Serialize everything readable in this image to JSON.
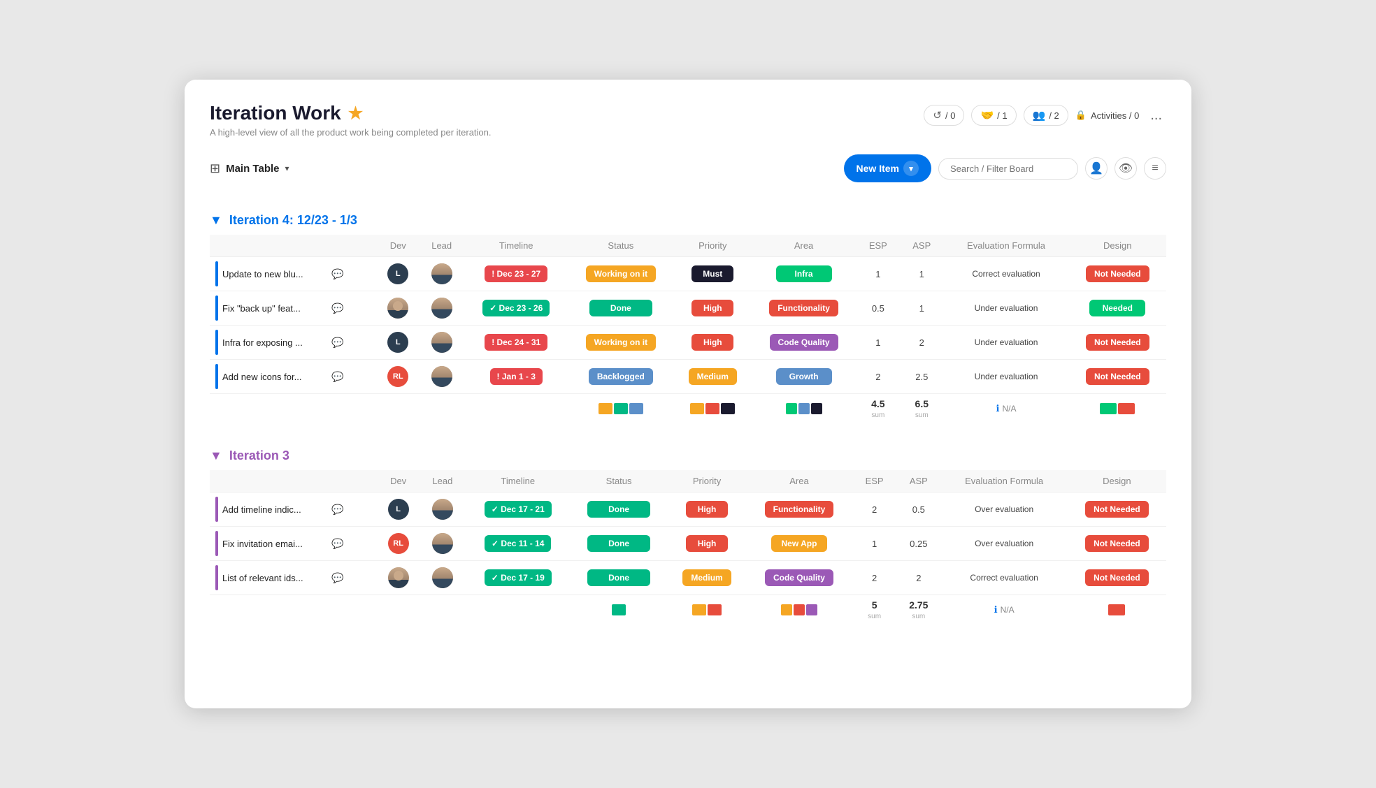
{
  "page": {
    "title": "Iteration Work",
    "subtitle": "A high-level view of all the product work being completed per iteration.",
    "star": "★"
  },
  "header": {
    "badge1_icon": "↺",
    "badge1_count": "/ 0",
    "badge2_icon": "🤝",
    "badge2_count": "/ 1",
    "badge3_icon": "👥",
    "badge3_count": "/ 2",
    "activities_label": "Activities / 0",
    "more": "..."
  },
  "toolbar": {
    "table_icon": "⊞",
    "main_table_label": "Main Table",
    "new_item_label": "New Item",
    "search_placeholder": "Search / Filter Board"
  },
  "iteration4": {
    "title": "Iteration 4: 12/23 - 1/3",
    "color": "blue",
    "columns": [
      "Dev",
      "Lead",
      "Timeline",
      "Status",
      "Priority",
      "Area",
      "ESP",
      "ASP",
      "Evaluation Formula",
      "Design"
    ],
    "rows": [
      {
        "text": "Update to new blu...",
        "dev_initials": "L",
        "dev_color": "dark",
        "lead_photo": true,
        "timeline_label": "! Dec 23 - 27",
        "timeline_type": "warning",
        "status": "Working on it",
        "status_type": "working",
        "priority": "Must",
        "priority_type": "must",
        "area": "Infra",
        "area_type": "infra",
        "esp": "1",
        "asp": "1",
        "eval": "Correct evaluation",
        "design": "Not Needed",
        "design_type": "not-needed"
      },
      {
        "text": "Fix \"back up\" feat...",
        "dev_initials": "",
        "dev_photo_group": true,
        "lead_photo": true,
        "timeline_label": "✓ Dec 23 - 26",
        "timeline_type": "success",
        "status": "Done",
        "status_type": "done",
        "priority": "High",
        "priority_type": "high",
        "area": "Functionality",
        "area_type": "functionality",
        "esp": "0.5",
        "asp": "1",
        "eval": "Under evaluation",
        "design": "Needed",
        "design_type": "needed"
      },
      {
        "text": "Infra for exposing ...",
        "dev_initials": "L",
        "dev_color": "dark",
        "lead_photo": true,
        "timeline_label": "! Dec 24 - 31",
        "timeline_type": "warning",
        "status": "Working on it",
        "status_type": "working",
        "priority": "High",
        "priority_type": "high",
        "area": "Code Quality",
        "area_type": "code-quality",
        "esp": "1",
        "asp": "2",
        "eval": "Under evaluation",
        "design": "Not Needed",
        "design_type": "not-needed"
      },
      {
        "text": "Add new icons for...",
        "dev_initials": "RL",
        "dev_color": "red",
        "lead_photo": true,
        "timeline_label": "! Jan 1 - 3",
        "timeline_type": "warning",
        "status": "Backlogged",
        "status_type": "backlogged",
        "priority": "Medium",
        "priority_type": "medium",
        "area": "Growth",
        "area_type": "growth",
        "esp": "2",
        "asp": "2.5",
        "eval": "Under evaluation",
        "design": "Not Needed",
        "design_type": "not-needed"
      }
    ],
    "summary": {
      "status_colors": [
        "#f5a623",
        "#00b884",
        "#5b8fc9"
      ],
      "priority_colors": [
        "#f5a623",
        "#e74c3c",
        "#1a1a2e"
      ],
      "area_colors": [
        "#00c875",
        "#5b8fc9",
        "#1a1a2e"
      ],
      "esp_sum": "4.5",
      "asp_sum": "6.5",
      "eval_label": "N/A",
      "design_colors": [
        "#00c875",
        "#e74c3c"
      ]
    }
  },
  "iteration3": {
    "title": "Iteration 3",
    "color": "purple",
    "columns": [
      "Dev",
      "Lead",
      "Timeline",
      "Status",
      "Priority",
      "Area",
      "ESP",
      "ASP",
      "Evaluation Formula",
      "Design"
    ],
    "rows": [
      {
        "text": "Add timeline indic...",
        "dev_initials": "L",
        "dev_color": "dark",
        "lead_photo": true,
        "timeline_label": "✓ Dec 17 - 21",
        "timeline_type": "success",
        "status": "Done",
        "status_type": "done",
        "priority": "High",
        "priority_type": "high",
        "area": "Functionality",
        "area_type": "functionality",
        "esp": "2",
        "asp": "0.5",
        "eval": "Over evaluation",
        "design": "Not Needed",
        "design_type": "not-needed"
      },
      {
        "text": "Fix invitation emai...",
        "dev_initials": "RL",
        "dev_color": "red",
        "lead_photo": true,
        "timeline_label": "✓ Dec 11 - 14",
        "timeline_type": "success",
        "status": "Done",
        "status_type": "done",
        "priority": "High",
        "priority_type": "high",
        "area": "New App",
        "area_type": "new-app",
        "esp": "1",
        "asp": "0.25",
        "eval": "Over evaluation",
        "design": "Not Needed",
        "design_type": "not-needed"
      },
      {
        "text": "List of relevant ids...",
        "dev_initials": "",
        "dev_photo_group": true,
        "lead_photo": true,
        "timeline_label": "✓ Dec 17 - 19",
        "timeline_type": "success",
        "status": "Done",
        "status_type": "done",
        "priority": "Medium",
        "priority_type": "medium",
        "area": "Code Quality",
        "area_type": "code-quality",
        "esp": "2",
        "asp": "2",
        "eval": "Correct evaluation",
        "design": "Not Needed",
        "design_type": "not-needed"
      }
    ],
    "summary": {
      "status_colors": [
        "#00b884"
      ],
      "priority_colors": [
        "#f5a623",
        "#e74c3c"
      ],
      "area_colors": [
        "#f5a623",
        "#e74c3c",
        "#9b59b6"
      ],
      "esp_sum": "5",
      "asp_sum": "2.75",
      "eval_label": "N/A",
      "design_colors": [
        "#e74c3c"
      ]
    }
  }
}
